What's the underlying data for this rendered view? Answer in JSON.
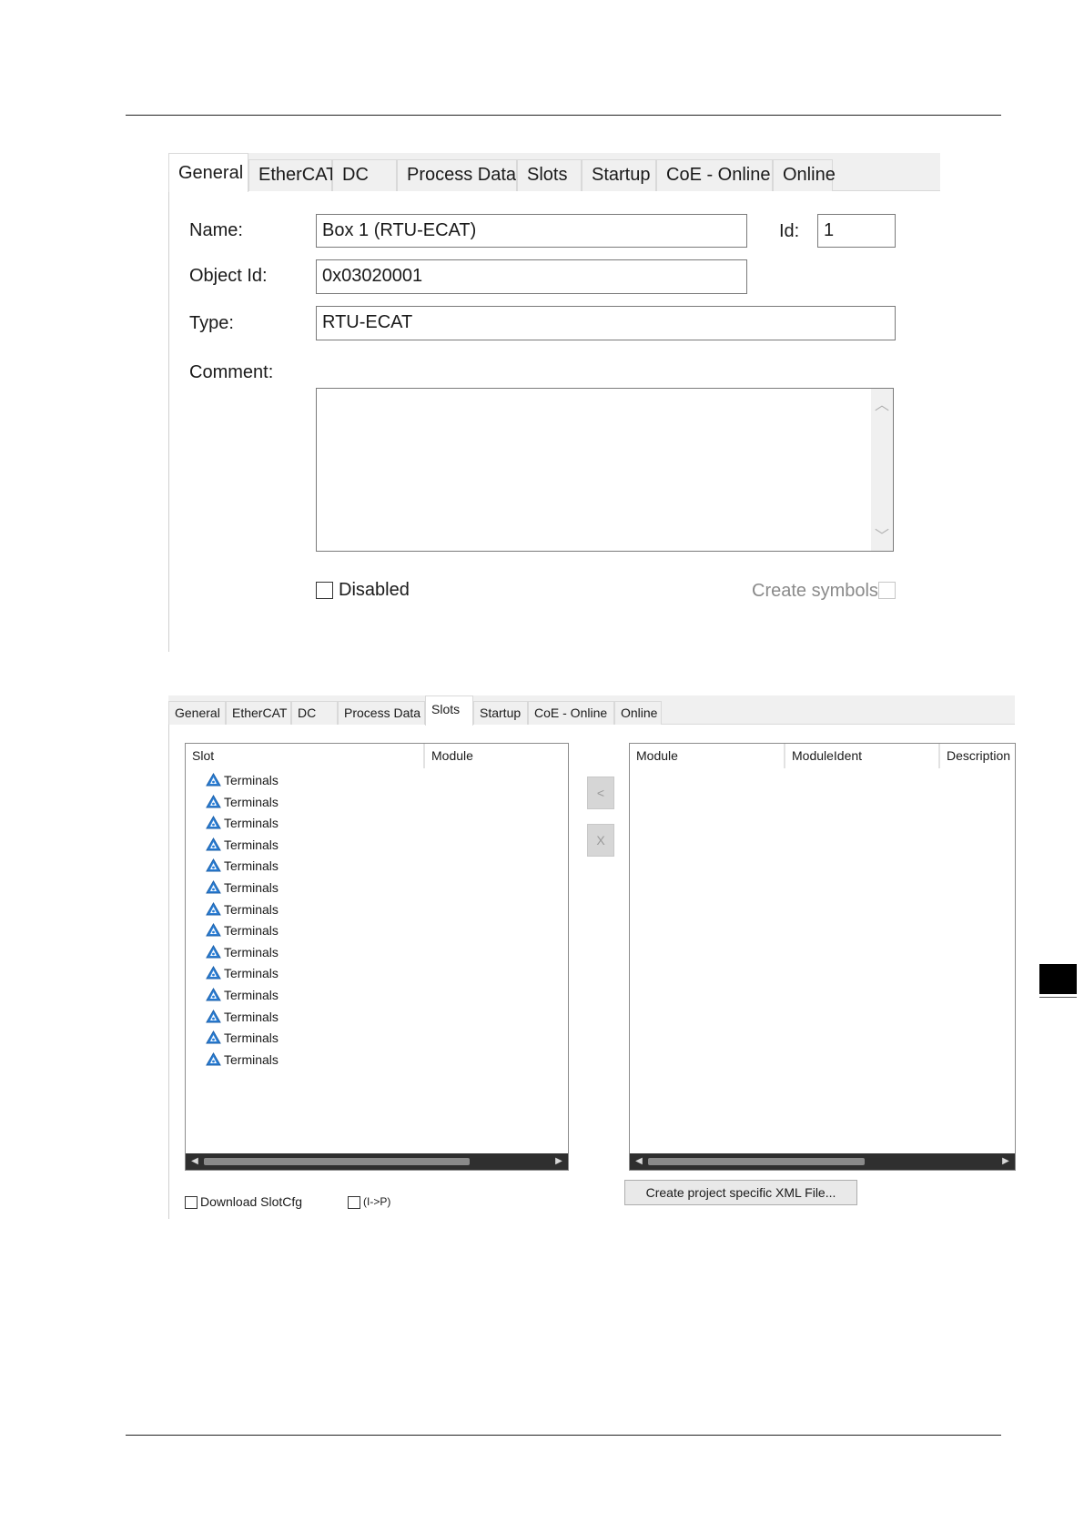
{
  "panel1": {
    "tabs": [
      "General",
      "EtherCAT",
      "DC",
      "Process Data",
      "Slots",
      "Startup",
      "CoE - Online",
      "Online"
    ],
    "active_tab": "General",
    "name_label": "Name:",
    "name_value": "Box 1 (RTU-ECAT)",
    "id_label": "Id:",
    "id_value": "1",
    "object_id_label": "Object Id:",
    "object_id_value": "0x03020001",
    "type_label": "Type:",
    "type_value": "RTU-ECAT",
    "comment_label": "Comment:",
    "comment_value": "",
    "disabled_label": "Disabled",
    "disabled_checked": false,
    "create_symbols_label": "Create symbols",
    "create_symbols_checked": false
  },
  "panel2": {
    "tabs": [
      "General",
      "EtherCAT",
      "DC",
      "Process Data",
      "Slots",
      "Startup",
      "CoE - Online",
      "Online"
    ],
    "active_tab": "Slots",
    "left_list": {
      "columns": [
        "Slot",
        "Module"
      ],
      "rows": [
        "Terminals",
        "Terminals",
        "Terminals",
        "Terminals",
        "Terminals",
        "Terminals",
        "Terminals",
        "Terminals",
        "Terminals",
        "Terminals",
        "Terminals",
        "Terminals",
        "Terminals",
        "Terminals"
      ],
      "row_icon": "warning-triangle-icon"
    },
    "insert_button": "<",
    "remove_button": "X",
    "right_list": {
      "columns": [
        "Module",
        "ModuleIdent",
        "Description"
      ]
    },
    "download_slotcfg_label": "Download SlotCfg",
    "i_to_p_label": "(I->P)",
    "xml_button": "Create project specific XML File..."
  },
  "colors": {
    "icon_blue": "#2b7fd6",
    "tab_bar": "#f0f0f0",
    "scrollbar": "#2f2f2f"
  }
}
